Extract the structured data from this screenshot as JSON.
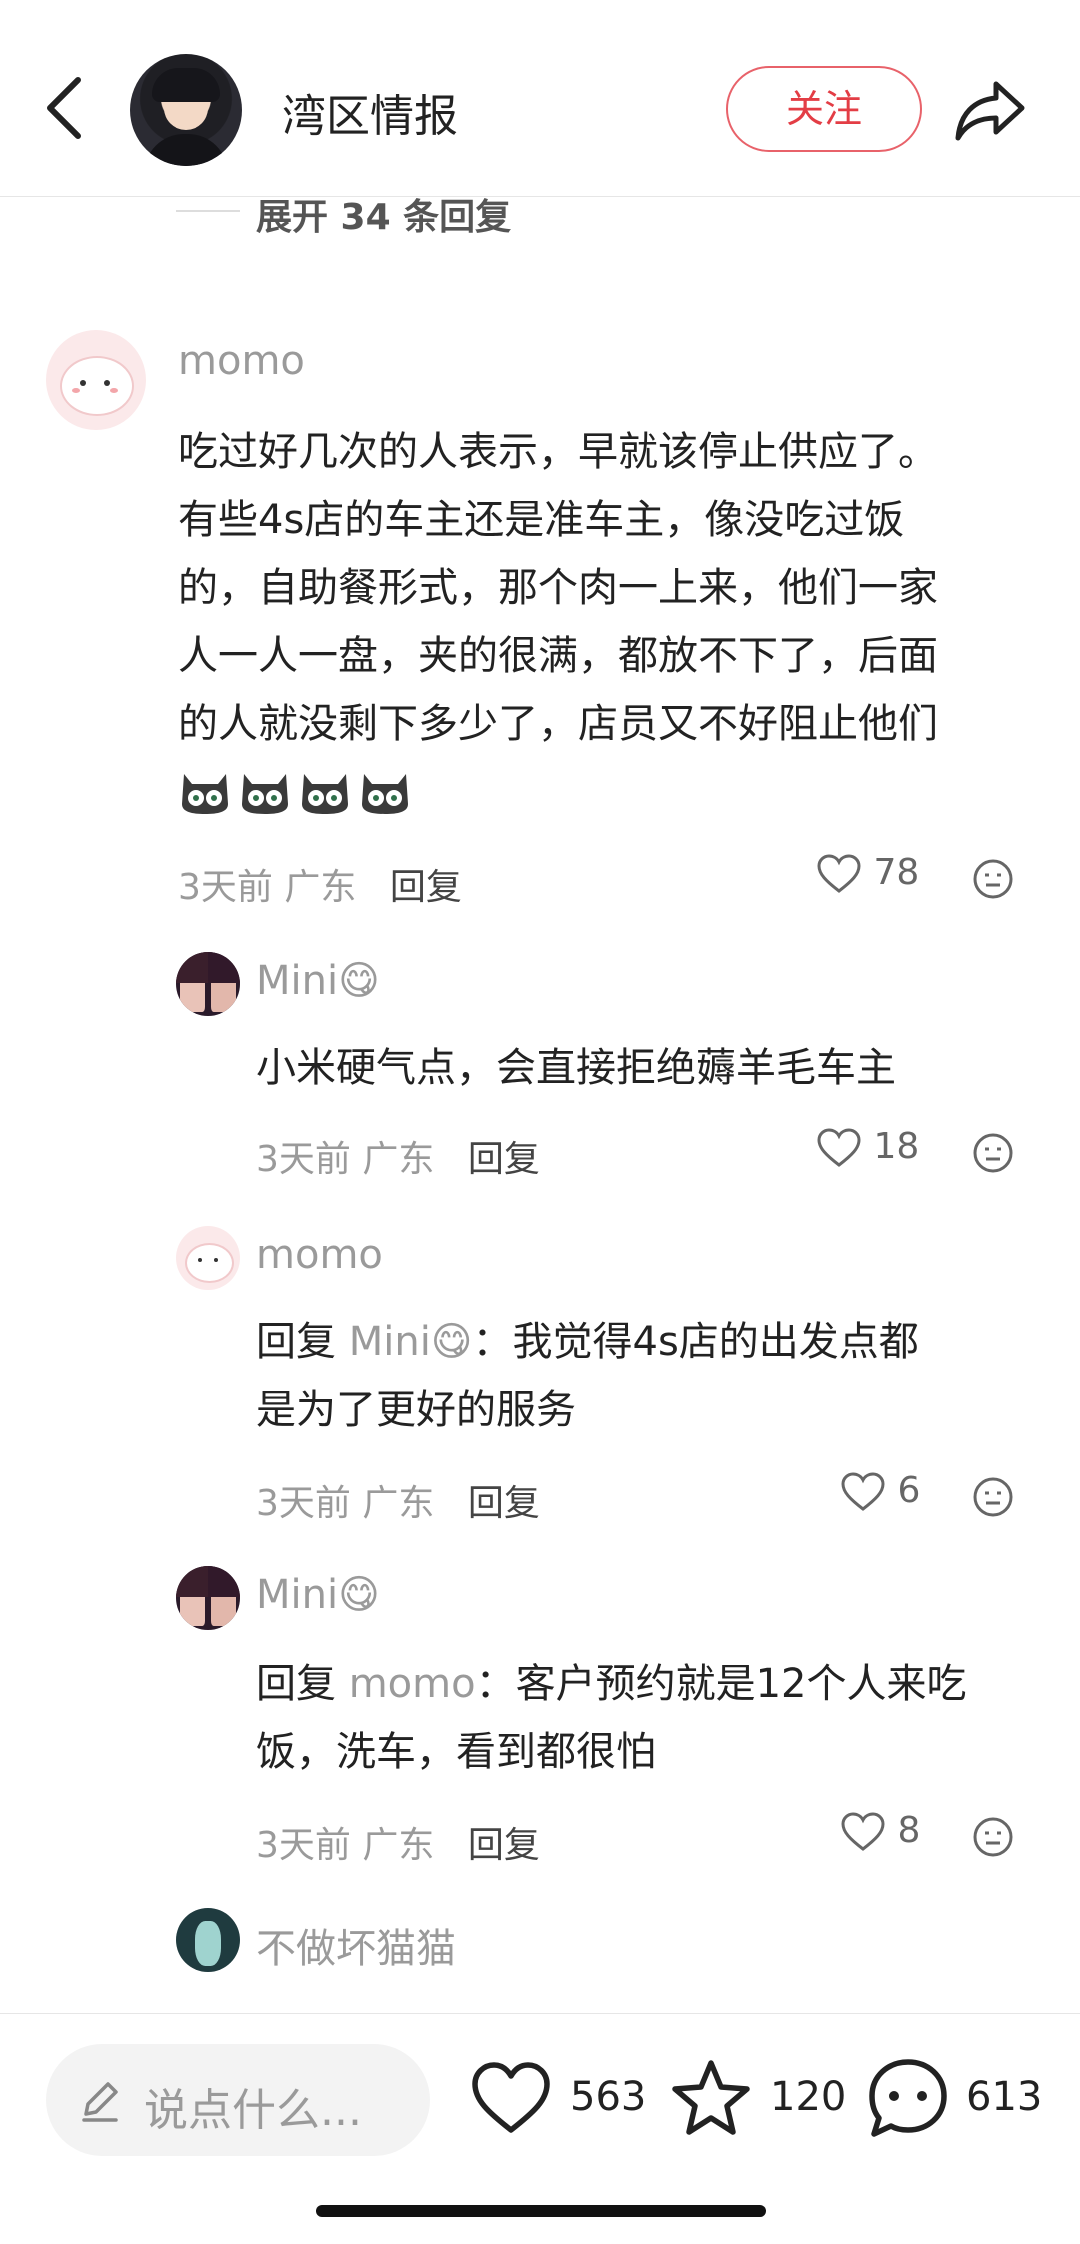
{
  "header": {
    "title": "湾区情报",
    "follow_label": "关注"
  },
  "expand": {
    "label": "展开 34 条回复"
  },
  "comments": [
    {
      "username": "momo",
      "text": "吃过好几次的人表示，早就该停止供应了。有些4s店的车主还是准车主，像没吃过饭的，自助餐形式，那个肉一上来，他们一家人一人一盘，夹的很满，都放不下了，后面的人就没剩下多少了，店员又不好阻止他们",
      "lines": [
        "吃过好几次的人表示，早就该停止供应了。",
        "有些4s店的车主还是准车主，像没吃过饭",
        "的，自助餐形式，那个肉一上来，他们一家",
        "人一人一盘，夹的很满，都放不下了，后面",
        "的人就没剩下多少了，店员又不好阻止他们"
      ],
      "emoji_count": 4,
      "time": "3天前",
      "location": "广东",
      "reply_label": "回复",
      "likes": "78"
    },
    {
      "username": "Mini😋",
      "lines": [
        "小米硬气点，会直接拒绝薅羊毛车主"
      ],
      "time": "3天前",
      "location": "广东",
      "reply_label": "回复",
      "likes": "18"
    },
    {
      "username": "momo",
      "reply_prefix": "回复",
      "reply_to": "Mini😋",
      "lines": [
        "：我觉得4s店的出发点都",
        "是为了更好的服务"
      ],
      "time": "3天前",
      "location": "广东",
      "reply_label": "回复",
      "likes": "6"
    },
    {
      "username": "Mini😋",
      "reply_prefix": "回复",
      "reply_to": "momo",
      "lines": [
        "：客户预约就是12个人来吃",
        "饭，洗车，看到都很怕"
      ],
      "time": "3天前",
      "location": "广东",
      "reply_label": "回复",
      "likes": "8"
    },
    {
      "username": "不做坏猫猫"
    }
  ],
  "bottom_bar": {
    "input_placeholder": "说点什么...",
    "likes": "563",
    "favorites": "120",
    "comments": "613"
  },
  "icons": {
    "back": "chevron-left-icon",
    "share": "share-arrow-icon",
    "like": "heart-icon",
    "dislike": "neutral-face-icon",
    "favorite": "star-icon",
    "comment": "speech-bubble-icon",
    "edit": "pencil-icon"
  },
  "colors": {
    "accent": "#e33d45"
  }
}
